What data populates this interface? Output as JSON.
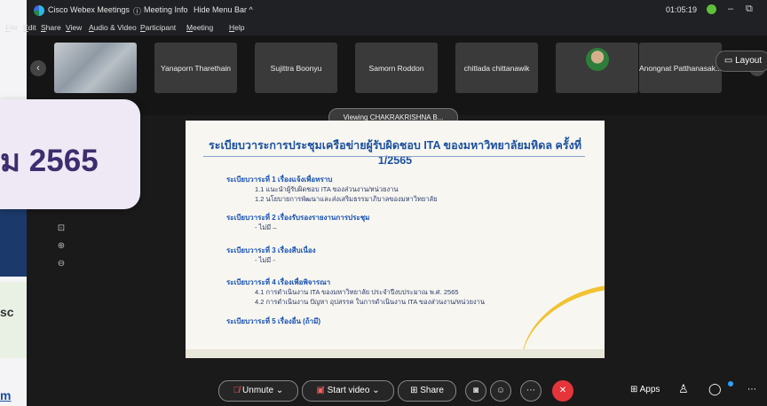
{
  "background_page": {
    "fragment_1": "sc",
    "fragment_2": "m"
  },
  "titlebar": {
    "app_name": "Cisco Webex Meetings",
    "meeting_info": "Meeting Info",
    "hide_menu": "Hide Menu Bar ^",
    "time": "01:05:19",
    "minimize": "–",
    "restore": "⧉"
  },
  "menu": [
    "File",
    "Edit",
    "Share",
    "View",
    "Audio & Video",
    "Participant",
    "Meeting",
    "Help"
  ],
  "participants": [
    {
      "name": "",
      "type": "video"
    },
    {
      "name": "Yanaporn Tharethain",
      "type": "name"
    },
    {
      "name": "Sujittra Boonyu",
      "type": "name"
    },
    {
      "name": "Samorn Roddon",
      "type": "name"
    },
    {
      "name": "chitlada chittanawik",
      "type": "name"
    },
    {
      "name": "",
      "type": "avatar"
    },
    {
      "name": "Anongnat Patthanasak...",
      "type": "name"
    }
  ],
  "layout_button": "Layout",
  "viewing_label": "Viewing CHAKRAKRISHNA B...",
  "callout_text": "ม 2565",
  "slide": {
    "title": "ระเบียบวาระการประชุมเครือข่ายผู้รับผิดชอบ ITA ของมหาวิทยาลัยมหิดล ครั้งที่ 1/2565",
    "items": [
      {
        "head": "ระเบียบวาระที่ 1 เรื่องแจ้งเพื่อทราบ",
        "subs": [
          "1.1 แนะนำผู้รับผิดชอบ ITA ของส่วนงาน/หน่วยงาน",
          "1.2 นโยบายการพัฒนาและส่งเสริมธรรมาภิบาลของมหาวิทยาลัย"
        ]
      },
      {
        "head": "ระเบียบวาระที่ 2 เรื่องรับรองรายงานการประชุม",
        "subs": [
          "- ไม่มี –"
        ]
      },
      {
        "head": "ระเบียบวาระที่ 3 เรื่องสืบเนื่อง",
        "subs": [
          "- ไม่มี -"
        ]
      },
      {
        "head": "ระเบียบวาระที่ 4 เรื่องเพื่อพิจารณา",
        "subs": [
          "4.1 การดำเนินงาน ITA ของมหาวิทยาลัย ประจำปีงบประมาณ พ.ศ. 2565",
          "4.2 การดำเนินงาน ปัญหา อุปสรรค ในการดำเนินงาน ITA ของส่วนงาน/หน่วยงาน"
        ]
      },
      {
        "head": "ระเบียบวาระที่ 5 เรื่องอื่น (ถ้ามี)",
        "subs": []
      }
    ]
  },
  "toolbar": {
    "unmute": "Unmute",
    "start_video": "Start video",
    "share": "Share",
    "apps": "Apps"
  },
  "colors": {
    "accent_red": "#e5353b",
    "slide_title": "#1b4f9e",
    "callout_text": "#3d2d6e"
  }
}
